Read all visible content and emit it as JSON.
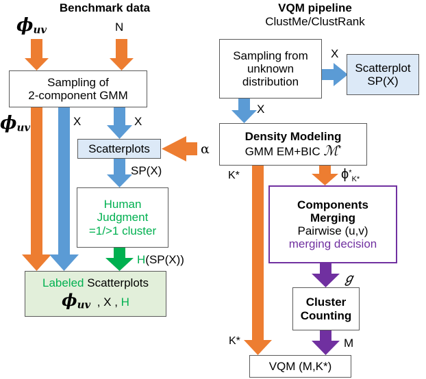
{
  "colors": {
    "orange": "#ED7D31",
    "blue": "#5B9BD5",
    "green": "#00B050",
    "purple": "#7030A0",
    "box_border": "#595959",
    "light_blue_fill": "#DCE9F7",
    "light_green_fill": "#E2EFDA"
  },
  "left_panel": {
    "title": "Benchmark data",
    "input_phi": "ϕ",
    "input_phi_sub": "uv",
    "input_n": "N",
    "phi_side_label": "ϕ",
    "phi_side_sub": "uv",
    "sampling_box": {
      "line1": "Sampling of",
      "line2": "2-component GMM"
    },
    "edge_x_left": "X",
    "edge_x_right": "X",
    "scatterplots_box": "Scatterplots",
    "alpha_label": "α",
    "edge_spx": "SP(X)",
    "human_box": {
      "line1": "Human",
      "line2": "Judgment",
      "line3": "=1/>1 cluster"
    },
    "edge_hspx": "H(SP(X))",
    "edge_hspx_green": "H",
    "edge_hspx_rest": "(SP(X))",
    "labeled_box": {
      "word_green": "Labeled",
      "word_black": "Scatterplots",
      "phi": "ϕ",
      "phi_sub": "uv",
      "comma_x": ", X ,",
      "h": "H"
    }
  },
  "right_panel": {
    "title": "VQM pipeline",
    "subtitle": "ClustMe/ClustRank",
    "sampling_box": {
      "line1": "Sampling from",
      "line2": "unknown",
      "line3": "distribution"
    },
    "edge_x_top": "X",
    "scatterplot_box": {
      "line1": "Scatterplot",
      "line2": "SP(X)"
    },
    "edge_x_down": "X",
    "density_box": {
      "line1": "Density Modeling",
      "line2_a": "GMM EM+BIC",
      "line2_math": "ℳ",
      "line2_sup": "*"
    },
    "edge_kstar_top": "K*",
    "edge_phi_kstar": "ϕ",
    "edge_phi_kstar_sup": "*",
    "edge_phi_kstar_sub": "K*",
    "merging_box": {
      "line1": "Components",
      "line2": "Merging",
      "line3": "Pairwise (u,v)",
      "line4": "merging decision"
    },
    "edge_script_g": "ℊ",
    "cluster_box": {
      "line1": "Cluster",
      "line2": "Counting"
    },
    "edge_kstar_bottom": "K*",
    "edge_m": "M",
    "vqm_box": "VQM (M,K*)"
  }
}
